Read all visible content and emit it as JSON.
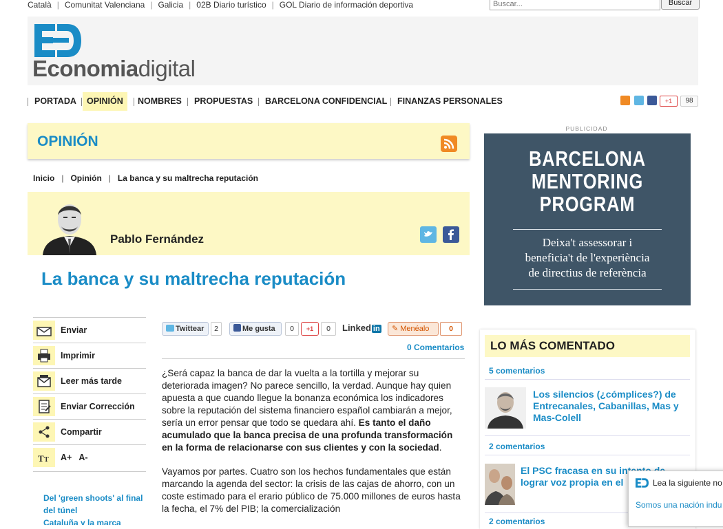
{
  "top_links": [
    "Català",
    "Comunitat Valenciana",
    "Galicia",
    "02B Diario turístico",
    "GOL Diario de información deportiva"
  ],
  "search": {
    "placeholder": "Buscar...",
    "button": "Buscar"
  },
  "brand": {
    "bold": "Economia",
    "light": "digital",
    "logo_letters": "ED"
  },
  "nav": [
    "PORTADA",
    "OPINIÓN",
    "NOMBRES",
    "PROPUESTAS",
    "BARCELONA CONFIDENCIAL",
    "FINANZAS PERSONALES"
  ],
  "nav_active": "OPINIÓN",
  "header_social": {
    "gplus_label": "+1",
    "count": "98"
  },
  "section_title": "OPINIÓN",
  "breadcrumb": [
    "Inicio",
    "Opinión",
    "La banca y su maltrecha reputación"
  ],
  "author": {
    "name": "Pablo Fernández"
  },
  "article": {
    "title": "La banca y su maltrecha reputación",
    "comments_link": "0 Comentarios",
    "p1_plain": "¿Será capaz la banca de dar la vuelta a la tortilla y mejorar su deteriorada imagen? No parece sencillo, la verdad. Aunque hay quien apuesta a que cuando llegue la bonanza económica los indicadores sobre la reputación del sistema financiero español cambiarán a mejor, sería un error pensar que todo se quedara ahí.",
    "p1_bold": "Es tanto el daño acumulado que la banca precisa de una profunda transformación en la forma de relacionarse con sus clientes y con la sociedad",
    "p1_end": ".",
    "p2": "Vayamos por partes. Cuatro son los hechos fundamentales que están marcando la agenda del sector: la crisis de las cajas de ahorro, con un coste estimado para el erario público de 75.000 millones de euros hasta la fecha, el 7% del PIB; la comercialización"
  },
  "share": {
    "twitter": "Twittear",
    "twitter_count": "2",
    "facebook": "Me gusta",
    "facebook_count": "0",
    "gplus": "+1",
    "gplus_count": "0",
    "linkedin": "Linked",
    "linkedin_in": "in",
    "meneame": "Menéalo",
    "meneame_count": "0"
  },
  "tools": [
    {
      "label": "Enviar",
      "icon": "envelope-icon"
    },
    {
      "label": "Imprimir",
      "icon": "printer-icon"
    },
    {
      "label": "Leer más tarde",
      "icon": "read-later-icon"
    },
    {
      "label": "Enviar Corrección",
      "icon": "correction-icon"
    },
    {
      "label": "Compartir",
      "icon": "share-icon"
    },
    {
      "label_plus": "A+",
      "label_minus": "A-",
      "icon": "text-size-icon"
    }
  ],
  "related": [
    "Del 'green shoots' al final del túnel",
    "Cataluña y la marca"
  ],
  "ad": {
    "label": "PUBLICIDAD",
    "title_lines": [
      "BARCELONA",
      "MENTORING",
      "PROGRAM"
    ],
    "sub_lines": [
      "Deixa't assessorar i",
      "beneficia't de l'experiència",
      "de directius de referència"
    ]
  },
  "most_commented": {
    "title": "LO MÁS COMENTADO",
    "items": [
      {
        "count": "5 comentarios",
        "title": "Los silencios (¿cómplices?) de Entrecanales, Cabanillas, Mas y Mas-Colell"
      },
      {
        "count": "2 comentarios",
        "title": "El PSC fracasa en su intento de lograr voz propia en el"
      },
      {
        "count": "2 comentarios",
        "title": ""
      }
    ]
  },
  "popup": {
    "text": "Lea la siguiente no",
    "link": "Somos una nación indu"
  },
  "colors": {
    "accent": "#1a8cc6",
    "highlight": "#fdf8c5",
    "ad_bg": "#3f5567",
    "rss": "#f08a24"
  }
}
